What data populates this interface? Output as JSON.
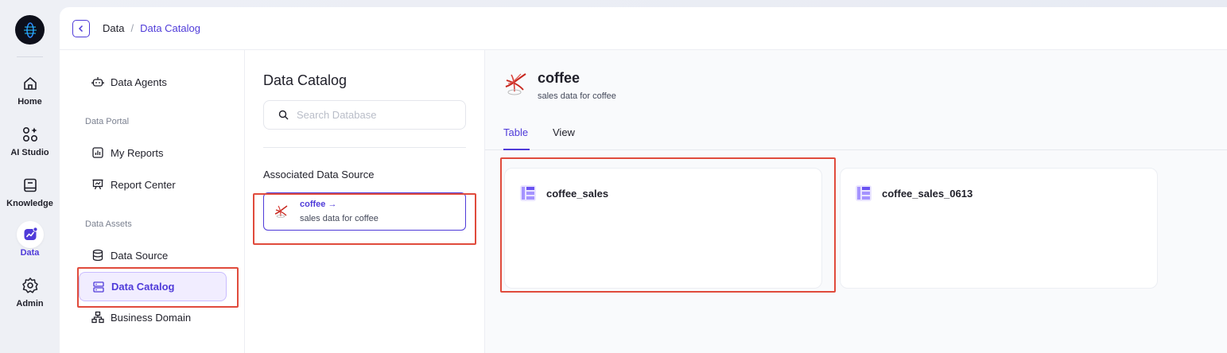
{
  "rail": {
    "logo_icon": "app-logo",
    "items": [
      {
        "label": "Home",
        "icon": "home-icon"
      },
      {
        "label": "AI Studio",
        "icon": "ai-studio-icon"
      },
      {
        "label": "Knowledge",
        "icon": "book-icon"
      },
      {
        "label": "Data",
        "icon": "chart-icon",
        "active": true
      },
      {
        "label": "Admin",
        "icon": "gear-icon"
      }
    ]
  },
  "header": {
    "back_icon": "chevron-left-icon",
    "breadcrumb": {
      "root": "Data",
      "separator": "/",
      "current": "Data Catalog"
    }
  },
  "nav": {
    "data_agents": "Data Agents",
    "group_portal": "Data Portal",
    "my_reports": "My Reports",
    "report_center": "Report Center",
    "group_assets": "Data Assets",
    "data_source": "Data Source",
    "data_catalog": "Data Catalog",
    "business_domain": "Business Domain"
  },
  "middle": {
    "title": "Data Catalog",
    "search_placeholder": "Search Database",
    "section_label": "Associated Data Source",
    "source": {
      "name": "coffee",
      "arrow": "→",
      "description": "sales data for coffee"
    }
  },
  "detail": {
    "title": "coffee",
    "description": "sales data for coffee",
    "tabs": [
      "Table",
      "View"
    ],
    "active_tab": "Table",
    "tables": [
      {
        "name": "coffee_sales"
      },
      {
        "name": "coffee_sales_0613"
      }
    ]
  },
  "colors": {
    "accent": "#4f3bd9",
    "highlight": "#e04b3c",
    "active_bg": "#f1edff"
  }
}
